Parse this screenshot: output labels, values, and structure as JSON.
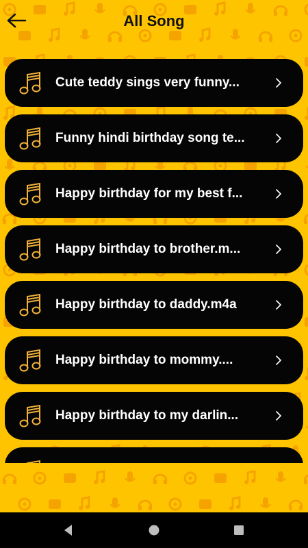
{
  "header": {
    "title": "All Song"
  },
  "icons": {
    "back": "arrow-left-icon",
    "song": "music-note-icon",
    "chevron": "chevron-right-icon",
    "nav_back": "triangle-back-icon",
    "nav_home": "circle-home-icon",
    "nav_recents": "square-recents-icon"
  },
  "colors": {
    "background": "#ffc400",
    "card": "#050505",
    "accent": "#f2b23a",
    "text": "#ffffff"
  },
  "songs": [
    {
      "label": "Cute teddy sings very funny..."
    },
    {
      "label": "Funny hindi birthday song te..."
    },
    {
      "label": "Happy birthday for my best f..."
    },
    {
      "label": "Happy birthday to brother.m..."
    },
    {
      "label": "Happy birthday to daddy.m4a"
    },
    {
      "label": "Happy birthday to mommy...."
    },
    {
      "label": "Happy birthday to my darlin..."
    },
    {
      "label": ""
    }
  ]
}
